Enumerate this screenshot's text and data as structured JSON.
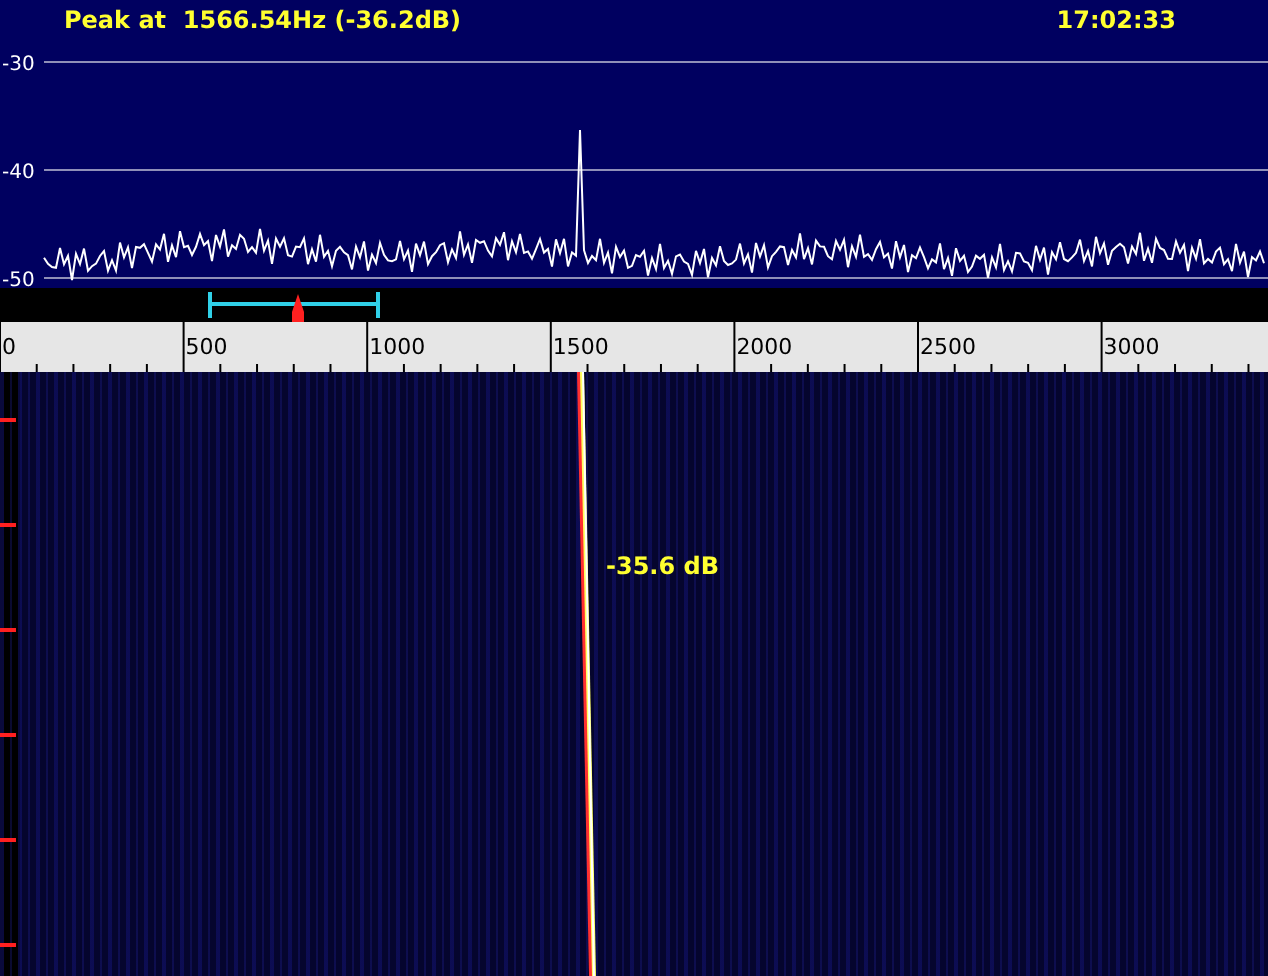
{
  "header": {
    "peak_readout": "Peak at  1566.54Hz (-36.2dB)",
    "time": "17:02:33"
  },
  "spectrum": {
    "y_labels": [
      "-30",
      "-40",
      "-50"
    ]
  },
  "ruler": {
    "labels": [
      "0",
      "500",
      "1000",
      "1500",
      "2000",
      "2500",
      "3000"
    ]
  },
  "waterfall": {
    "signal_label": "-35.6 dB"
  }
}
